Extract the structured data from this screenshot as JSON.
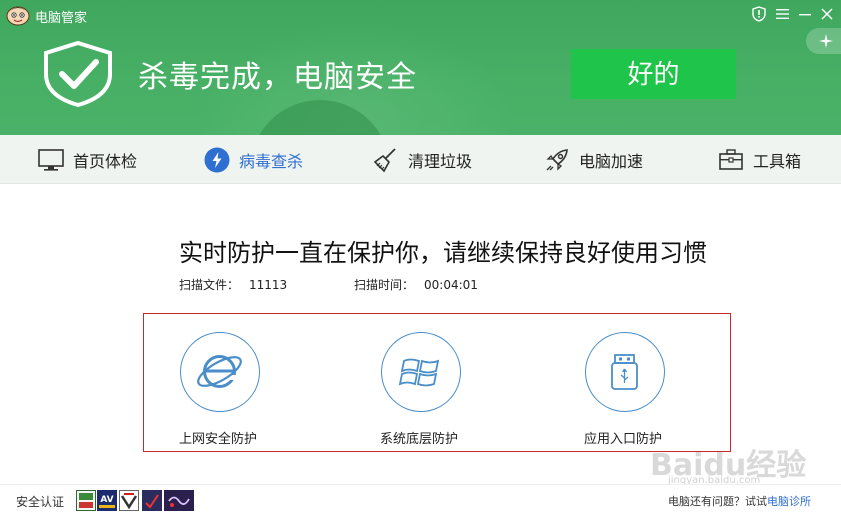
{
  "titlebar": {
    "app_title": "电脑管家",
    "buttons": [
      "shield-settings-icon",
      "menu-icon",
      "minimize-icon",
      "close-icon"
    ]
  },
  "status": {
    "message": "杀毒完成，电脑安全",
    "ok_label": "好的"
  },
  "nav": {
    "items": [
      {
        "label": "首页体检",
        "icon": "monitor-icon"
      },
      {
        "label": "病毒查杀",
        "icon": "lightning-icon",
        "active": true
      },
      {
        "label": "清理垃圾",
        "icon": "broom-icon"
      },
      {
        "label": "电脑加速",
        "icon": "rocket-icon"
      },
      {
        "label": "工具箱",
        "icon": "toolbox-icon"
      }
    ]
  },
  "main": {
    "headline": "实时防护一直在保护你，请继续保持良好使用习惯",
    "scan_files_label": "扫描文件：",
    "scan_files_value": "11113",
    "scan_time_label": "扫描时间：",
    "scan_time_value": "00:04:01"
  },
  "protections": [
    {
      "label": "上网安全防护",
      "icon": "ie-browser-icon"
    },
    {
      "label": "系统底层防护",
      "icon": "windows-icon"
    },
    {
      "label": "应用入口防护",
      "icon": "usb-icon"
    }
  ],
  "footer": {
    "cert_label": "安全认证",
    "help_text": "电脑还有问题？试试",
    "help_link": "电脑诊所"
  },
  "watermark": {
    "text": "Baidu经验",
    "sub": "jingyan.baidu.com"
  },
  "colors": {
    "header_green": "#47b065",
    "ok_button": "#1fc54a",
    "accent_blue": "#2f6fd2",
    "protect_border": "#c9282d",
    "circle_blue": "#4a8ec9"
  }
}
